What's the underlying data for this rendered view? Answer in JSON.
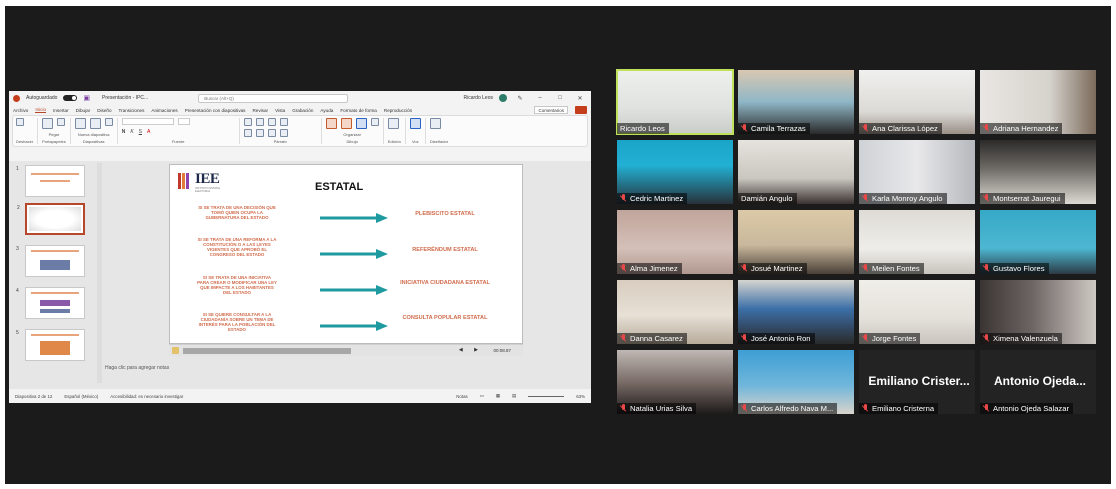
{
  "colors": {
    "screen_bg": "#1b1b1b",
    "active_speaker": "#bfe25a",
    "slide_text": "#d16b4b",
    "arrow": "#1f9aa0",
    "muted_mic": "#e84848"
  },
  "ppt": {
    "autosave_label": "Autoguardado",
    "file_name": "Presentación - IPC...",
    "search_placeholder": "Buscar (Alt+Q)",
    "user_name": "Ricardo Leos",
    "menu": [
      "Archivo",
      "Inicio",
      "Insertar",
      "Dibujar",
      "Diseño",
      "Transiciones",
      "Animaciones",
      "Presentación con diapositivas",
      "Revisar",
      "Vista",
      "Grabación",
      "Ayuda",
      "Formato de forma",
      "Reproducción"
    ],
    "comments_label": "Comentarios",
    "ribbon_groups": [
      "Deshacer",
      "Portapapeles",
      "Diapositivas",
      "Fuente",
      "Párrafo",
      "Dibujo",
      "Voz",
      "Diseñador"
    ],
    "ribbon_buttons": {
      "paste": "Pegar",
      "new_slide": "Nueva diapositiva",
      "reuse": "Volver a usar las diapositivas",
      "arrange": "Organizar",
      "styles": "Estilos rápidos",
      "format": "Formas",
      "editing": "Edición",
      "dictate": "Dictar",
      "designer": "Ideas de diseño"
    },
    "slide": {
      "logo_text": "IEE",
      "logo_sub": "INSTITUTO ESTATAL ELECTORAL",
      "title": "ESTATAL",
      "rows": [
        {
          "left": "SI SE TRATA DE UNA DECISIÓN QUE TOMÓ QUIEN OCUPA LA GUBERNATURA DEL ESTADO",
          "right": "PLEBISCITO ESTATAL"
        },
        {
          "left": "SI SE TRATA DE UNA REFORMA A LA CONSTITUCIÓN O A LAS LEYES VIGENTES QUE APROBÓ EL CONGRESO DEL ESTADO",
          "right": "REFERÉNDUM ESTATAL"
        },
        {
          "left": "SI SE TRATA DE UNA INICIATIVA PARA CREAR O MODIFICAR UNA LEY QUE IMPACTE A LOS HABITANTES DEL ESTADO",
          "right": "INICIATIVA CIUDADANA ESTATAL"
        },
        {
          "left": "SI SE QUIERE CONSULTAR A LA CIUDADANÍA SOBRE UN TEMA DE INTERÉS PARA LA POBLACIÓN DEL ESTADO",
          "right": "CONSULTA POPULAR ESTATAL"
        }
      ]
    },
    "media_time": "00:08.87",
    "thumb_numbers": [
      "1",
      "2",
      "3",
      "4",
      "5"
    ],
    "notes_placeholder": "Haga clic para agregar notas",
    "status": {
      "slide": "Diapositiva 2 de 12",
      "language": "Español (México)",
      "accessibility": "Accesibilidad: es necesario investigar",
      "notes": "Notas",
      "zoom": "63%"
    }
  },
  "participants": [
    {
      "name": "Ricardo Leos",
      "muted": false,
      "active": true
    },
    {
      "name": "Camila Terrazas",
      "muted": true
    },
    {
      "name": "Ana Clarissa López",
      "muted": true
    },
    {
      "name": "Adriana Hernandez",
      "muted": true
    },
    {
      "name": "Cedric Martinez",
      "muted": true
    },
    {
      "name": "Damián Angulo",
      "muted": false
    },
    {
      "name": "Karla Monroy Angulo",
      "muted": true
    },
    {
      "name": "Montserrat Jauregui",
      "muted": true
    },
    {
      "name": "Alma Jimenez",
      "muted": true
    },
    {
      "name": "Josué Martinez",
      "muted": true
    },
    {
      "name": "Meilen Fontes",
      "muted": true
    },
    {
      "name": "Gustavo Flores",
      "muted": true
    },
    {
      "name": "Danna Casarez",
      "muted": true
    },
    {
      "name": "José Antonio Ron",
      "muted": true
    },
    {
      "name": "Jorge Fontes",
      "muted": true
    },
    {
      "name": "Ximena Valenzuela",
      "muted": true
    },
    {
      "name": "Natalia Urias Silva",
      "muted": true
    },
    {
      "name": "Carlos Alfredo Nava M...",
      "muted": true
    },
    {
      "name": "Emiliano Cristerna",
      "muted": true,
      "video": false,
      "display": "Emiliano Crister..."
    },
    {
      "name": "Antonio Ojeda Salazar",
      "muted": true,
      "video": false,
      "display": "Antonio Ojeda..."
    }
  ]
}
